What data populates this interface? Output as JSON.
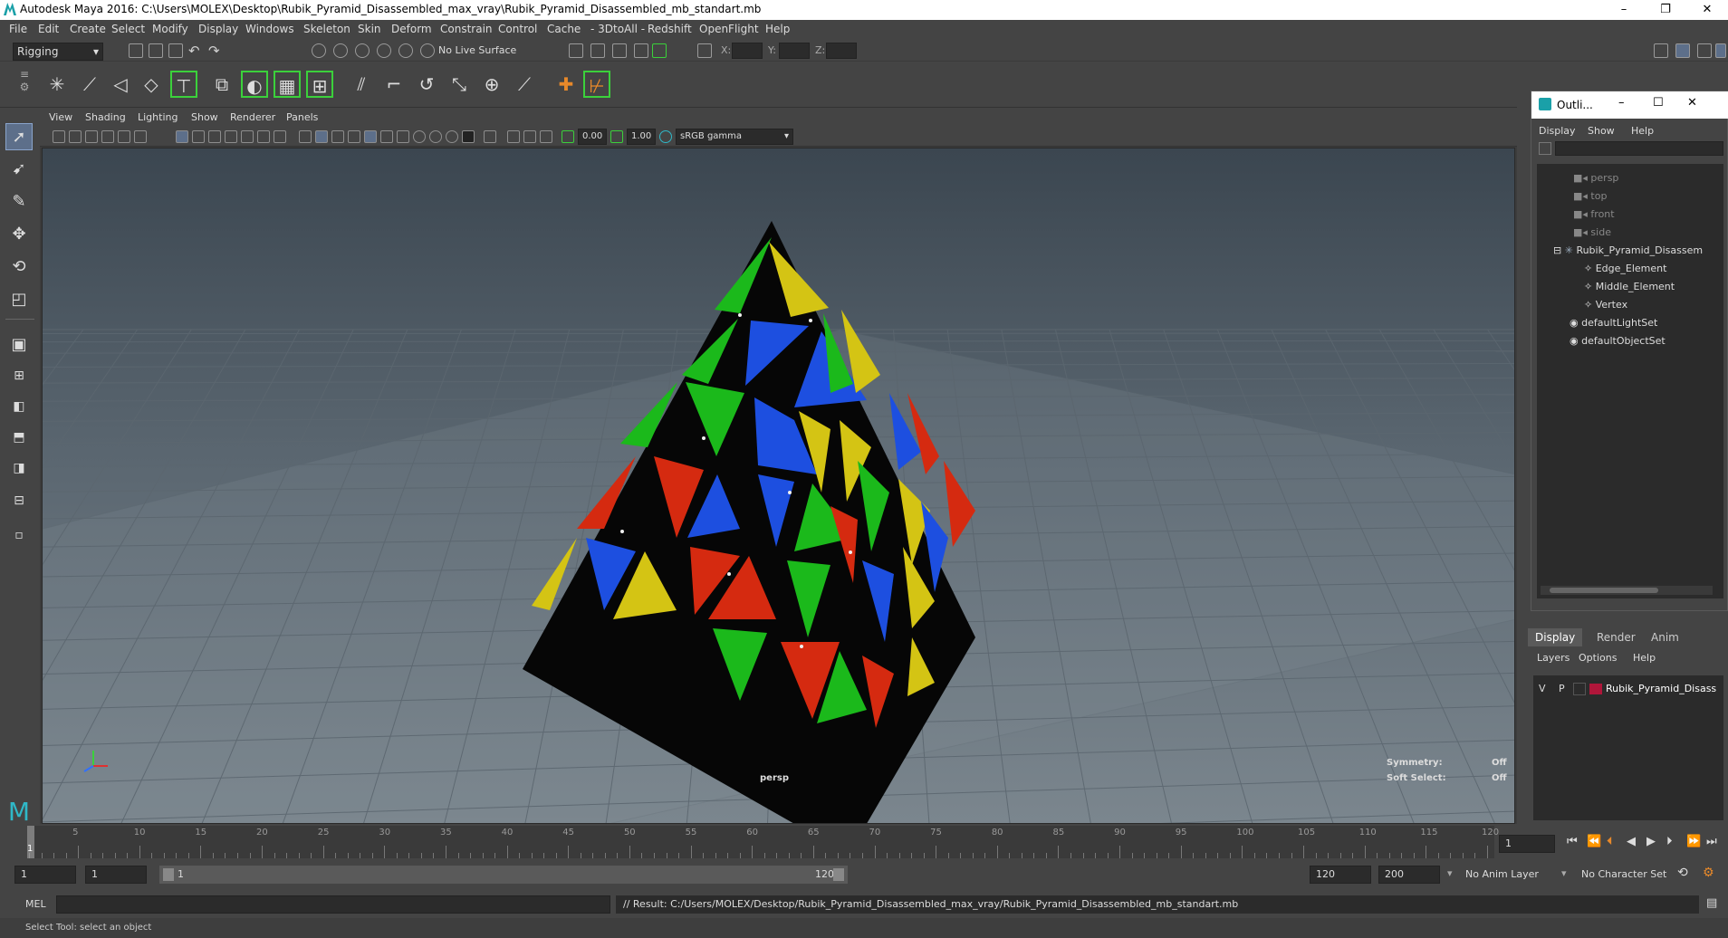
{
  "window": {
    "title": "Autodesk Maya 2016: C:\\Users\\MOLEX\\Desktop\\Rubik_Pyramid_Disassembled_max_vray\\Rubik_Pyramid_Disassembled_mb_standart.mb",
    "minimize": "–",
    "maximize": "❐",
    "close": "✕"
  },
  "menubar": [
    "File",
    "Edit",
    "Create",
    "Select",
    "Modify",
    "Display",
    "Windows",
    "Skeleton",
    "Skin",
    "Deform",
    "Constrain",
    "Control",
    "Cache",
    "- 3DtoAll -",
    "Redshift",
    "OpenFlight",
    "Help"
  ],
  "statusline": {
    "mode": "Rigging",
    "live_surface": "No Live Surface",
    "x_label": "X:",
    "y_label": "Y:",
    "z_label": "Z:"
  },
  "panel": {
    "menus": [
      "View",
      "Shading",
      "Lighting",
      "Show",
      "Renderer",
      "Panels"
    ],
    "exposure": "0.00",
    "gamma": "1.00",
    "color_space": "sRGB gamma"
  },
  "viewport": {
    "camera": "persp",
    "symmetry_label": "Symmetry:",
    "symmetry_value": "Off",
    "softselect_label": "Soft Select:",
    "softselect_value": "Off",
    "grid_color": "#5c6770"
  },
  "outliner": {
    "title": "Outli...",
    "menus": [
      "Display",
      "Show",
      "Help"
    ],
    "items": [
      {
        "label": "persp",
        "dim": true
      },
      {
        "label": "top",
        "dim": true
      },
      {
        "label": "front",
        "dim": true
      },
      {
        "label": "side",
        "dim": true
      },
      {
        "label": "Rubik_Pyramid_Disassem",
        "dim": false
      },
      {
        "label": "Edge_Element",
        "dim": false
      },
      {
        "label": "Middle_Element",
        "dim": false
      },
      {
        "label": "Vertex",
        "dim": false
      },
      {
        "label": "defaultLightSet",
        "dim": false
      },
      {
        "label": "defaultObjectSet",
        "dim": false
      }
    ]
  },
  "layers": {
    "tabs": [
      "Display",
      "Render",
      "Anim"
    ],
    "menus": [
      "Layers",
      "Options",
      "Help"
    ],
    "row": {
      "v": "V",
      "p": "P",
      "name": "Rubik_Pyramid_Disass",
      "color": "#b0163a"
    }
  },
  "timeline": {
    "ticks": [
      "5",
      "10",
      "15",
      "20",
      "25",
      "30",
      "35",
      "40",
      "45",
      "50",
      "55",
      "60",
      "65",
      "70",
      "75",
      "80",
      "85",
      "90",
      "95",
      "100",
      "105",
      "110",
      "115",
      "120"
    ],
    "current_frame": "1",
    "start_label": "1"
  },
  "range": {
    "start": "1",
    "anim_start": "1",
    "slider_start": "1",
    "slider_end": "120",
    "end": "120",
    "anim_end": "200",
    "anim_layer": "No Anim Layer",
    "char_set": "No Character Set"
  },
  "cmdline": {
    "lang": "MEL",
    "result": "// Result: C:/Users/MOLEX/Desktop/Rubik_Pyramid_Disassembled_max_vray/Rubik_Pyramid_Disassembled_mb_standart.mb"
  },
  "helpline": "Select Tool: select an object"
}
